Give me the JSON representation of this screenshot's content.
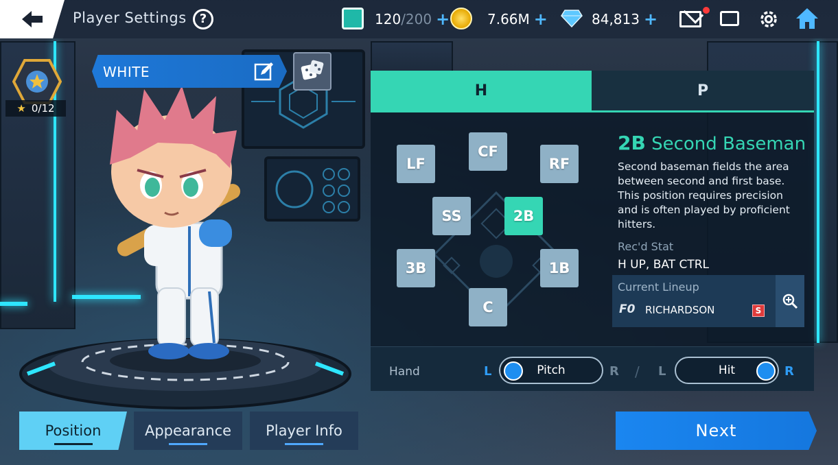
{
  "header": {
    "title": "Player Settings",
    "stamina_current": "120",
    "stamina_max": "/200",
    "gold": "7.66M",
    "gems": "84,813"
  },
  "player": {
    "name": "WHITE",
    "stars": "0/12"
  },
  "tabs": {
    "hitter": "H",
    "pitcher": "P"
  },
  "positions": [
    "LF",
    "CF",
    "RF",
    "SS",
    "2B",
    "3B",
    "1B",
    "C"
  ],
  "selected_position": {
    "code": "2B",
    "name": "Second Baseman",
    "description": "Second baseman fields the area between second and first base. This position requires precision and is often played by proficient hitters.",
    "recd_stat_label": "Rec'd Stat",
    "recd_stat_value": "H UP, BAT CTRL",
    "lineup_label": "Current Lineup",
    "lineup_player": "RICHARDSON",
    "lineup_badge": "F0",
    "lineup_grade": "S"
  },
  "hand": {
    "label": "Hand",
    "pitch_label": "Pitch",
    "pitch_value": "L",
    "hit_label": "Hit",
    "hit_value": "R",
    "left": "L",
    "right": "R",
    "separator": "/"
  },
  "bottom_tabs": {
    "position": "Position",
    "appearance": "Appearance",
    "player_info": "Player Info",
    "active": "Position"
  },
  "next_label": "Next",
  "colors": {
    "accent_teal": "#35d6b4",
    "accent_blue": "#1e8ef0",
    "notification": "#ff3b3b"
  }
}
